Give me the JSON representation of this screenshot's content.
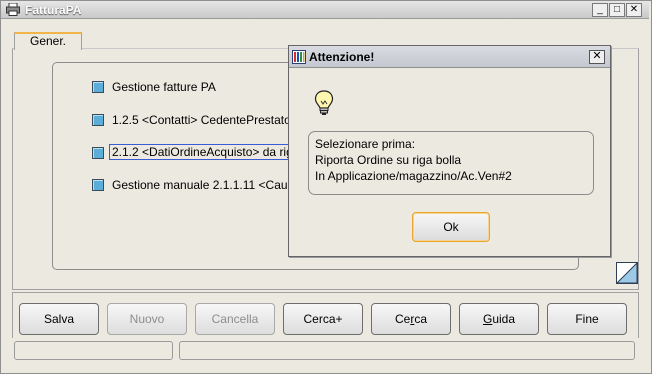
{
  "window": {
    "title": "FatturaPA",
    "minimize_glyph": "_",
    "maximize_glyph": "□",
    "close_glyph": "✕"
  },
  "tabs": [
    {
      "label": "Gener."
    }
  ],
  "rows": [
    {
      "label": "Gestione fatture PA"
    },
    {
      "label": "1.2.5 <Contatti> CedentePrestatore"
    },
    {
      "label": "2.1.2 <DatiOrdineAcquisto> da riga bolla"
    },
    {
      "label": "Gestione manuale 2.1.1.11 <Causale>"
    }
  ],
  "toolbar": {
    "buttons": [
      {
        "label": "Salva",
        "enabled": true
      },
      {
        "label": "Nuovo",
        "enabled": false
      },
      {
        "label": "Cancella",
        "enabled": false
      },
      {
        "label": "Cerca+",
        "enabled": true
      },
      {
        "label": "Cerca",
        "enabled": true,
        "underline_index": 2
      },
      {
        "label": "Guida",
        "enabled": true,
        "underline_index": 0
      },
      {
        "label": "Fine",
        "enabled": true
      }
    ]
  },
  "dialog": {
    "title": "Attenzione!",
    "close_glyph": "✕",
    "message": [
      "Selezionare prima:",
      "Riporta Ordine su riga bolla",
      "In Applicazione/magazzino/Ac.Ven#2"
    ],
    "ok_label": "Ok"
  },
  "colors": {
    "checkbox": "#5aaed9",
    "tab_accent": "#f0b64c",
    "focus_border": "#e9a52e"
  },
  "icons": {
    "app": "printer-icon",
    "dialog": "app-logo-icon",
    "message": "lightbulb-icon",
    "corner": "resize-triangle-icon"
  }
}
